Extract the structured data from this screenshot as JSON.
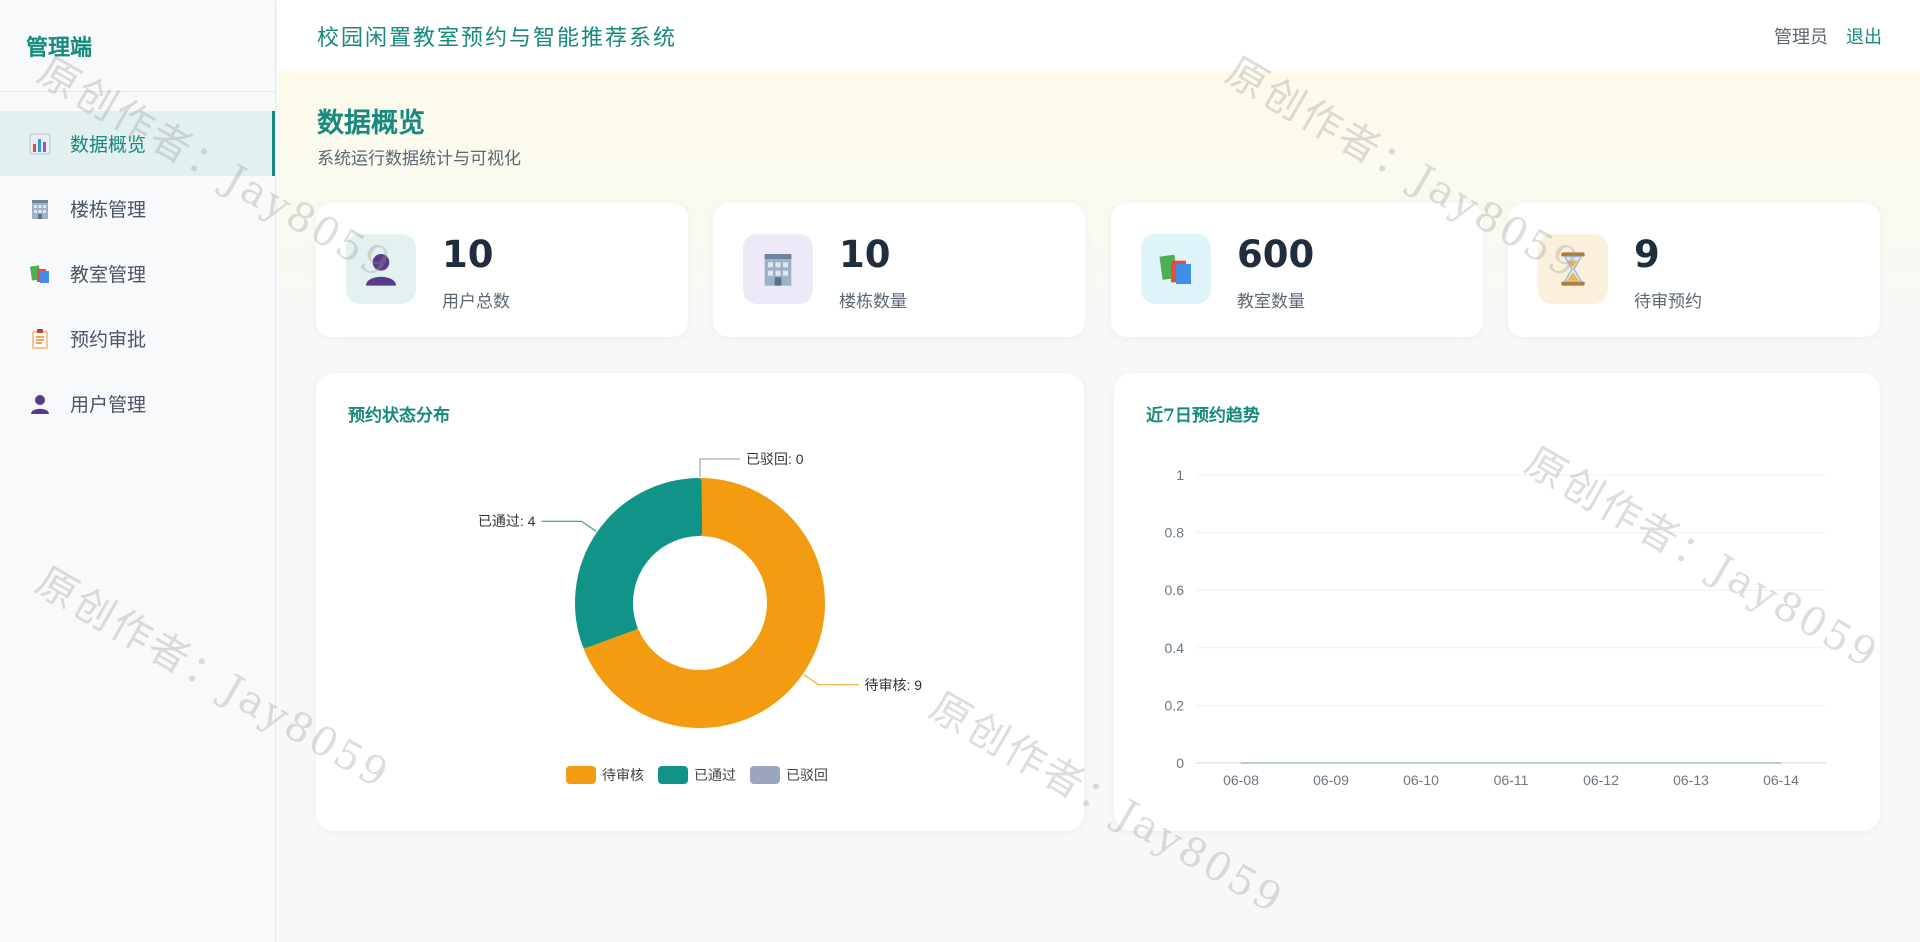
{
  "sidebar": {
    "brand": "管理端",
    "items": [
      {
        "label": "数据概览",
        "icon": "bar-chart-icon",
        "active": true
      },
      {
        "label": "楼栋管理",
        "icon": "building-icon",
        "active": false
      },
      {
        "label": "教室管理",
        "icon": "books-icon",
        "active": false
      },
      {
        "label": "预约审批",
        "icon": "clipboard-icon",
        "active": false
      },
      {
        "label": "用户管理",
        "icon": "user-icon",
        "active": false
      }
    ]
  },
  "header": {
    "title": "校园闲置教室预约与智能推荐系统",
    "user": "管理员",
    "logout": "退出"
  },
  "page": {
    "title": "数据概览",
    "subtitle": "系统运行数据统计与可视化"
  },
  "stats": [
    {
      "value": "10",
      "label": "用户总数",
      "icon": "user-icon",
      "bg": "#e3f1f0"
    },
    {
      "value": "10",
      "label": "楼栋数量",
      "icon": "building-icon",
      "bg": "#ede9f8"
    },
    {
      "value": "600",
      "label": "教室数量",
      "icon": "books-icon",
      "bg": "#dff4f8"
    },
    {
      "value": "9",
      "label": "待审预约",
      "icon": "hourglass-icon",
      "bg": "#fbf0dc"
    }
  ],
  "panels": {
    "status_title": "预约状态分布",
    "trend_title": "近7日预约趋势"
  },
  "watermark": "原创作者：Jay8059",
  "colors": {
    "accent": "#17897f",
    "pending": "#f39c12",
    "approved": "#119387",
    "rejected": "#9aa6bd"
  },
  "chart_data": [
    {
      "type": "pie",
      "title": "预约状态分布",
      "labels": [
        "待审核",
        "已通过",
        "已驳回"
      ],
      "values": [
        9,
        4,
        0
      ],
      "data_labels": [
        "待审核: 9",
        "已通过: 4",
        "已驳回: 0"
      ],
      "legend": [
        "待审核",
        "已通过",
        "已驳回"
      ],
      "legend_position": "bottom"
    },
    {
      "type": "line",
      "title": "近7日预约趋势",
      "x": [
        "06-08",
        "06-09",
        "06-10",
        "06-11",
        "06-12",
        "06-13",
        "06-14"
      ],
      "series": [
        {
          "values": [
            0,
            0,
            0,
            0,
            0,
            0,
            0
          ]
        }
      ],
      "ylim": [
        0,
        1
      ],
      "yticks": [
        "1",
        "0.8",
        "0.6",
        "0.4",
        "0.2",
        "0"
      ],
      "grid": true
    }
  ]
}
